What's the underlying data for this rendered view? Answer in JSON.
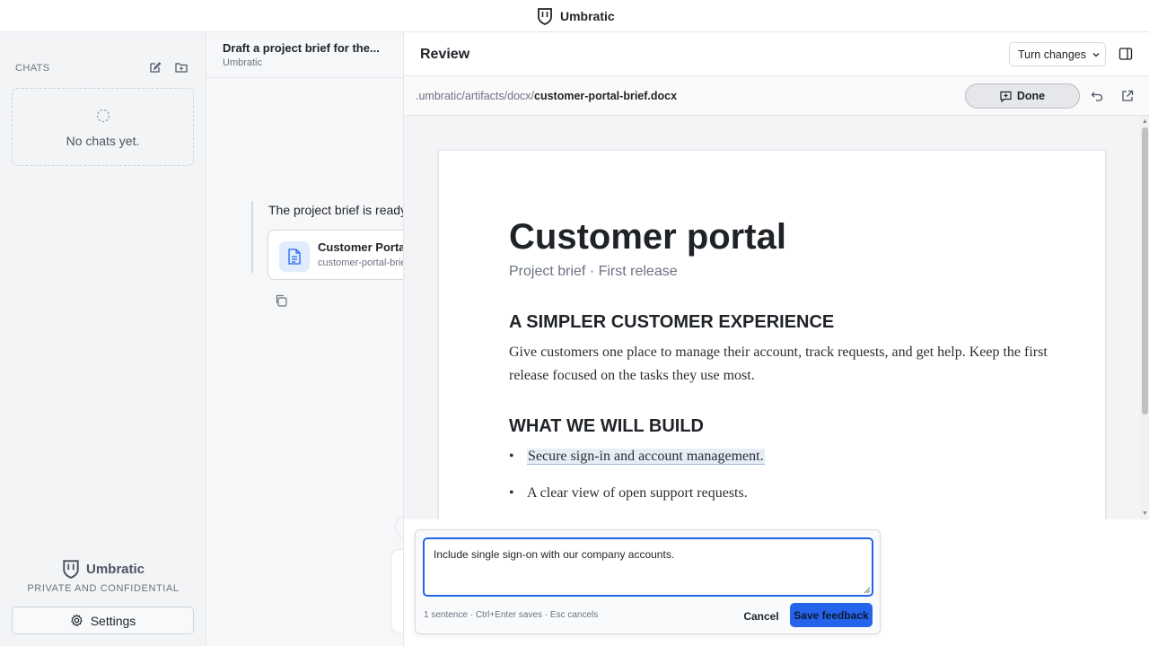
{
  "app": {
    "name": "Umbratic"
  },
  "sidebar": {
    "chats_heading": "CHATS",
    "empty_text": "No chats yet.",
    "brand_name": "Umbratic",
    "brand_tagline": "PRIVATE AND CONFIDENTIAL",
    "settings_label": "Settings"
  },
  "chat": {
    "title": "Draft a project brief for the...",
    "subtitle": "Umbratic",
    "message": "The project brief is ready.",
    "file_name": "Customer Portal",
    "file_sub": "customer-portal-brie"
  },
  "review": {
    "title": "Review",
    "turn_changes_label": "Turn changes",
    "path_prefix": ".umbratic/artifacts/docx/",
    "path_file": "customer-portal-brief.docx",
    "done_label": "Done"
  },
  "document": {
    "title": "Customer portal",
    "subtitle": "Project brief · First release",
    "heading1": "A SIMPLER CUSTOMER EXPERIENCE",
    "paragraph1": "Give customers one place to manage their account, track requests, and get help. Keep the first release focused on the tasks they use most.",
    "heading2": "WHAT WE WILL BUILD",
    "bullets": [
      "Secure sign-in and account management.",
      "A clear view of open support requests."
    ],
    "bullet_mark": "•"
  },
  "feedback": {
    "value": "Include single sign-on with our company accounts.",
    "hint": "1 sentence · Ctrl+Enter saves · Esc cancels",
    "cancel_label": "Cancel",
    "save_label": "Save feedback"
  },
  "colors": {
    "accent": "#2563eb",
    "highlight": "#e6edf6"
  }
}
